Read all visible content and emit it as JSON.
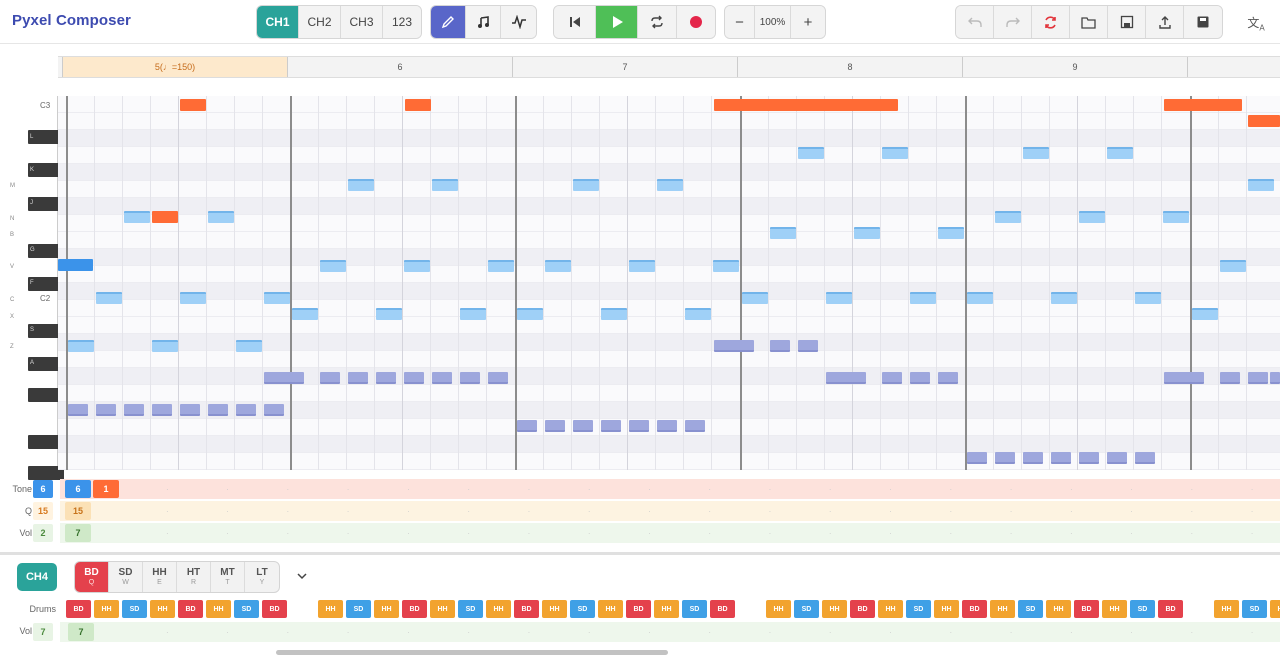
{
  "app": {
    "title": "Pyxel Composer"
  },
  "toolbar": {
    "channels": [
      {
        "label": "CH1",
        "active": true
      },
      {
        "label": "CH2"
      },
      {
        "label": "CH3"
      },
      {
        "label": "123"
      }
    ],
    "tools": [
      {
        "icon": "pencil-icon",
        "active": true
      },
      {
        "icon": "music-note-icon"
      },
      {
        "icon": "waveform-icon"
      }
    ],
    "transport": [
      {
        "icon": "skip-back-icon"
      },
      {
        "icon": "play-icon"
      },
      {
        "icon": "loop-icon"
      },
      {
        "icon": "record-icon"
      }
    ],
    "zoom": {
      "minus": "−",
      "value": "100%",
      "plus": "+"
    },
    "actions": [
      {
        "icon": "undo-icon",
        "disabled": true
      },
      {
        "icon": "redo-icon",
        "disabled": true
      },
      {
        "icon": "refresh-icon"
      },
      {
        "icon": "folder-icon"
      },
      {
        "icon": "save-icon"
      },
      {
        "icon": "upload-icon"
      },
      {
        "icon": "disk-icon"
      }
    ],
    "translate_icon": "translate-icon"
  },
  "ruler": {
    "measures": [
      "5(♩=150)",
      "6",
      "7",
      "8",
      "9"
    ]
  },
  "keyboard": {
    "c_labels": [
      "C3",
      "C2"
    ],
    "key_letters": [
      "J",
      "L",
      "K",
      "M",
      "J",
      "N",
      "B",
      "G",
      "V",
      "F",
      "C",
      "X",
      "S",
      "Z",
      "A"
    ]
  },
  "lanes": {
    "tone": {
      "label": "Tone",
      "value": "6",
      "cells": [
        "6",
        "1"
      ]
    },
    "q": {
      "label": "Q",
      "value": "15",
      "cells": [
        "15"
      ]
    },
    "vol": {
      "label": "Vol",
      "value": "2",
      "cells": [
        "7"
      ]
    }
  },
  "ch4": {
    "label": "CH4",
    "drums": [
      {
        "name": "BD",
        "key": "Q",
        "active": true
      },
      {
        "name": "SD",
        "key": "W"
      },
      {
        "name": "HH",
        "key": "E"
      },
      {
        "name": "HT",
        "key": "R"
      },
      {
        "name": "MT",
        "key": "T"
      },
      {
        "name": "LT",
        "key": "Y"
      }
    ],
    "row_label": "Drums",
    "vol_label": "Vol",
    "vol_value": "7",
    "vol_cell": "7",
    "pattern": [
      "BD",
      "HH",
      "SD",
      "HH",
      "BD",
      "HH",
      "SD",
      "BD",
      "",
      "HH",
      "SD",
      "HH",
      "BD",
      "HH",
      "SD",
      "HH",
      "BD",
      "HH",
      "SD",
      "HH",
      "BD",
      "HH",
      "SD",
      "BD",
      "",
      "HH",
      "SD",
      "HH",
      "BD",
      "HH",
      "SD",
      "HH",
      "BD",
      "HH",
      "SD",
      "HH",
      "BD",
      "HH",
      "SD",
      "BD",
      "",
      "HH",
      "SD",
      "HH"
    ]
  },
  "colors": {
    "BD": "#e4414c",
    "SD": "#3fa0e6",
    "HH": "#f2a32e",
    "accent": "#2aa39a"
  }
}
